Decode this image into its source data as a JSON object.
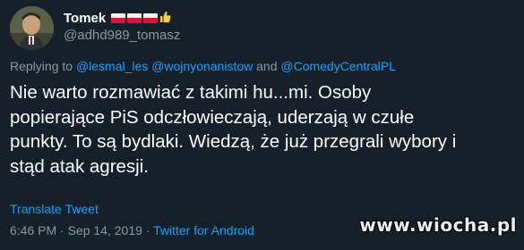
{
  "author": {
    "display_name": "Tomek",
    "handle": "@adhd989_tomasz",
    "flags": [
      "poland-flag-icon",
      "poland-flag-icon",
      "poland-flag-icon"
    ],
    "emoji": "thumbs-up-icon"
  },
  "reply": {
    "prefix": "Replying to",
    "mentions": [
      "@lesmal_les",
      "@wojnyonanistow"
    ],
    "conjunction": "and",
    "last_mention": "@ComedyCentralPL"
  },
  "tweet": {
    "text": "Nie warto rozmawiać z takimi hu...mi. Osoby\npopierające PiS odczłowieczają, uderzają w czułe\npunkty. To są bydlaki. Wiedzą, że już przegrali wybory i\nstąd atak agresji."
  },
  "translate_label": "Translate Tweet",
  "meta": {
    "time": "6:46 PM",
    "separator": " · ",
    "date": "Sep 14, 2019",
    "source": "Twitter for Android"
  },
  "watermark": "www.wiocha.pl",
  "colors": {
    "background": "#15202b",
    "text": "#ffffff",
    "muted": "#8899a6",
    "link": "#1da1f2"
  }
}
